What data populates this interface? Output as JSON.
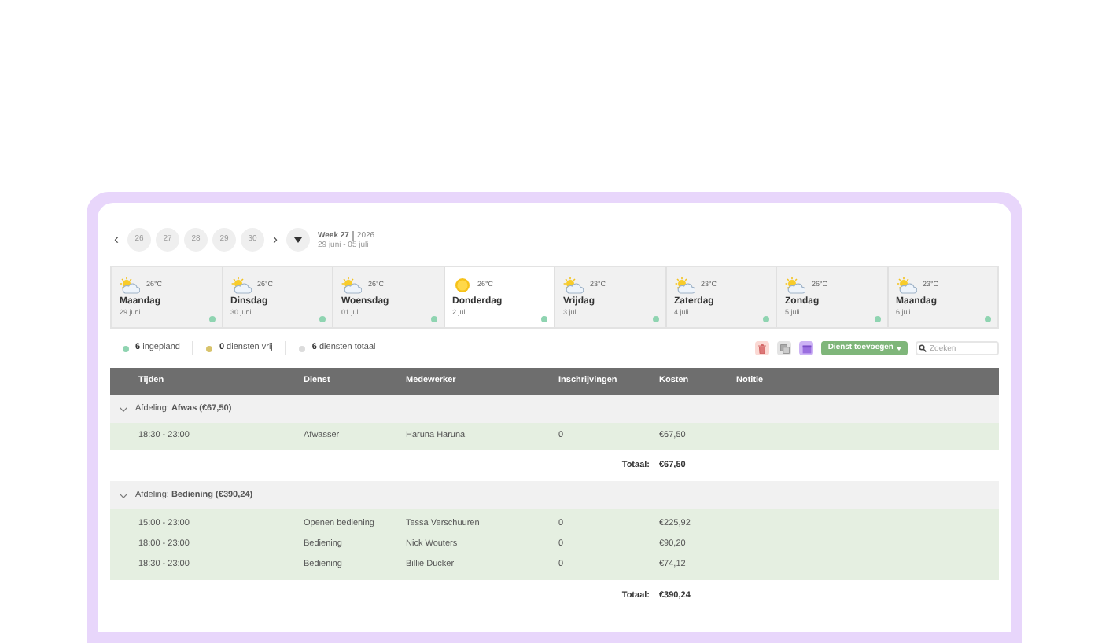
{
  "nav": {
    "prev": "‹",
    "dates": [
      {
        "label": "26",
        "selected": false
      },
      {
        "label": "27",
        "selected": false
      },
      {
        "label": "28",
        "selected": false
      },
      {
        "label": "29",
        "selected": false
      },
      {
        "label": "30",
        "selected": false
      }
    ],
    "next": "›",
    "week": "Week 27",
    "year": "2026",
    "range": "29 juni - 05 juli"
  },
  "days": [
    {
      "name": "Maandag",
      "date": "29 juni",
      "temp": "26°C",
      "kind": "partly_cloudy",
      "selected": false
    },
    {
      "name": "Dinsdag",
      "date": "30 juni",
      "temp": "26°C",
      "kind": "partly_cloudy",
      "selected": false
    },
    {
      "name": "Woensdag",
      "date": "01 juli",
      "temp": "26°C",
      "kind": "partly_cloudy",
      "selected": false
    },
    {
      "name": "Donderdag",
      "date": "2 juli",
      "temp": "26°C",
      "kind": "sunny",
      "selected": true
    },
    {
      "name": "Vrijdag",
      "date": "3 juli",
      "temp": "23°C",
      "kind": "partly_cloudy",
      "selected": false
    },
    {
      "name": "Zaterdag",
      "date": "4 juli",
      "temp": "23°C",
      "kind": "partly_cloudy",
      "selected": false
    },
    {
      "name": "Zondag",
      "date": "5 juli",
      "temp": "26°C",
      "kind": "partly_cloudy",
      "selected": false
    },
    {
      "name": "Maandag",
      "date": "6 juli",
      "temp": "23°C",
      "kind": "partly_cloudy",
      "selected": false
    }
  ],
  "summary": [
    {
      "count": "6",
      "label": "ingepland",
      "color": "#8fd4b1"
    },
    {
      "count": "0",
      "label": "diensten vrij",
      "color": "#d8c36b"
    },
    {
      "count": "6",
      "label": "diensten totaal",
      "color": "#dcdcdc"
    }
  ],
  "toolbar": {
    "icon_buttons": [
      {
        "kind": "delete"
      },
      {
        "kind": "copy"
      },
      {
        "kind": "calendar"
      }
    ],
    "add_button": "Dienst toevoegen",
    "search": {
      "placeholder": "Zoeken"
    }
  },
  "table": {
    "columns": [
      "Tijden",
      "Dienst",
      "Medewerker",
      "Inschrijvingen",
      "Kosten",
      "Notitie"
    ],
    "groups": [
      {
        "label": "Afdeling: **Afwas (€67,50)**",
        "expanded": true,
        "rows": [
          [
            "18:30 - 23:00",
            "Afwasser",
            "Haruna Haruna",
            "0",
            "€67,50"
          ]
        ],
        "total_label": "Totaal:",
        "total": "€67,50"
      },
      {
        "label": "Afdeling: **Bediening (€390,24)**",
        "expanded": true,
        "rows": [
          [
            "15:00 - 23:00",
            "Openen bediening",
            "Tessa Verschuuren",
            "0",
            "€225,92"
          ],
          [
            "18:00 - 23:00",
            "Bediening",
            "Nick Wouters",
            "0",
            "€90,20"
          ],
          [
            "18:30 - 23:00",
            "Bediening",
            "Billie Ducker",
            "0",
            "€74,12"
          ]
        ],
        "total_label": "Totaal:",
        "total": "€390,24"
      }
    ]
  }
}
